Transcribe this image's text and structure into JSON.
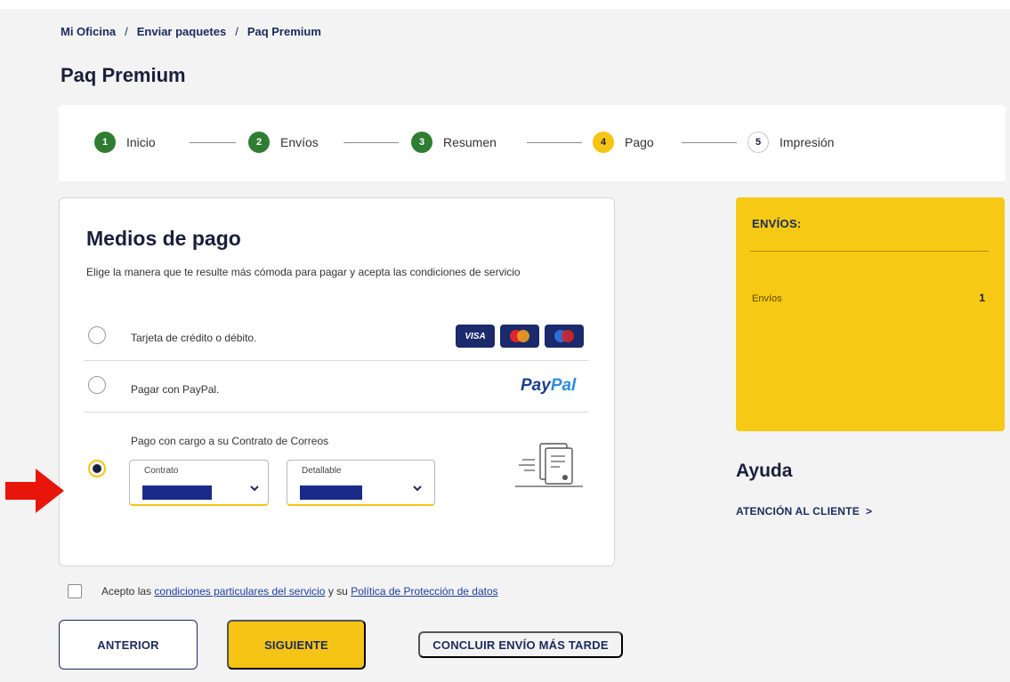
{
  "breadcrumb": {
    "items": [
      "Mi Oficina",
      "Enviar paquetes",
      "Paq Premium"
    ],
    "separator": "/"
  },
  "page_title": "Paq Premium",
  "stepper": {
    "steps": [
      {
        "num": "1",
        "label": "Inicio",
        "state": "done"
      },
      {
        "num": "2",
        "label": "Envíos",
        "state": "done"
      },
      {
        "num": "3",
        "label": "Resumen",
        "state": "done"
      },
      {
        "num": "4",
        "label": "Pago",
        "state": "current"
      },
      {
        "num": "5",
        "label": "Impresión",
        "state": "pending"
      }
    ]
  },
  "payment": {
    "title": "Medios de pago",
    "description": "Elige la manera que te resulte más cómoda para pagar y acepta las condiciones de servicio",
    "options": [
      {
        "label": "Tarjeta de crédito o débito.",
        "selected": false,
        "logos": [
          "visa-logo",
          "mastercard-logo",
          "maestro-logo"
        ]
      },
      {
        "label": "Pagar con PayPal.",
        "selected": false,
        "logo_text": "PayPal"
      },
      {
        "label": "Pago con cargo a su Contrato de Correos",
        "selected": true
      }
    ],
    "contrato_label": "Contrato",
    "detallable_label": "Detallable"
  },
  "terms": {
    "prefix": "Acepto las",
    "link1": "condiciones particulares del servicio",
    "middle": "y su",
    "link2": "Política de Protección de datos"
  },
  "buttons": {
    "prev": "ANTERIOR",
    "next": "SIGUIENTE",
    "later": "CONCLUIR ENVÍO MÁS TARDE"
  },
  "summary": {
    "title": "ENVÍOS:",
    "row_label": "Envíos",
    "row_value": "1"
  },
  "help": {
    "title": "Ayuda",
    "link": "ATENCIÓN AL CLIENTE",
    "link_chevron": ">"
  },
  "colors": {
    "accent_yellow": "#f6c414",
    "done_green": "#2e7d32",
    "navy": "#1b2a5c",
    "annotation_red": "#e8150b"
  }
}
